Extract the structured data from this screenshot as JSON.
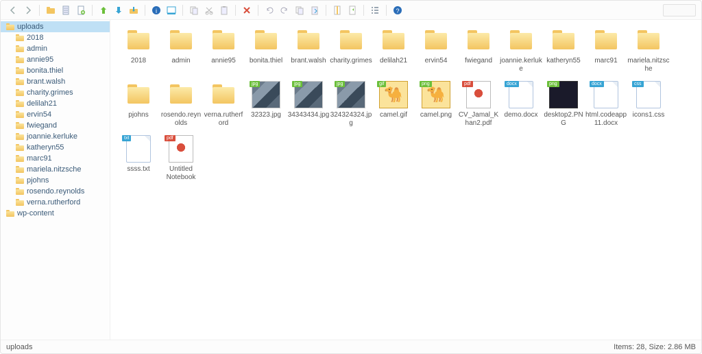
{
  "toolbar": [
    {
      "name": "back-icon",
      "svg": "<path d='M9 2 L4 7 L9 12' stroke='#9aa' stroke-width='1.5' fill='none'/>"
    },
    {
      "name": "forward-icon",
      "svg": "<path d='M5 2 L10 7 L5 12' stroke='#9aa' stroke-width='1.5' fill='none'/>"
    },
    {
      "sep": true
    },
    {
      "name": "folder-icon",
      "svg": "<rect x='1' y='4' width='12' height='8' rx='1' fill='#f3c561'/><rect x='1' y='2' width='5' height='3' rx='1' fill='#f3c561'/>"
    },
    {
      "name": "document-icon",
      "svg": "<rect x='3' y='1' width='8' height='12' fill='#eef' stroke='#9ab'/><path d='M4 4h6M4 7h6M4 10h6' stroke='#9ab'/>"
    },
    {
      "name": "new-icon",
      "svg": "<rect x='3' y='1' width='8' height='12' fill='#fff' stroke='#9ab'/><circle cx='10' cy='10' r='3' fill='#6b3'/><path d='M10 8v4M8 10h4' stroke='#fff'/>"
    },
    {
      "sep": true
    },
    {
      "name": "upload-icon",
      "svg": "<path d='M7 2 L11 6 L9 6 L9 12 L5 12 L5 6 L3 6 Z' fill='#6bbf3a'/>"
    },
    {
      "name": "download-icon",
      "svg": "<path d='M7 12 L11 8 L9 8 L9 2 L5 2 L5 8 L3 8 Z' fill='#37a4d4'/>"
    },
    {
      "name": "download-folder-icon",
      "svg": "<rect x='1' y='5' width='12' height='7' rx='1' fill='#f3c561'/><path d='M7 9 L9 7 L8 7 L8 2 L6 2 L6 7 L5 7 Z' fill='#37a4d4'/>"
    },
    {
      "sep": true
    },
    {
      "name": "info-icon",
      "svg": "<circle cx='7' cy='7' r='6' fill='#2a6db8'/><text x='7' y='11' font-size='9' text-anchor='middle' fill='#fff'>i</text>"
    },
    {
      "name": "preview-icon",
      "svg": "<rect x='1' y='2' width='12' height='9' fill='#fff' stroke='#37a4d4'/><rect x='1' y='11' width='12' height='2' fill='#37a4d4'/>"
    },
    {
      "sep": true
    },
    {
      "name": "copy-icon",
      "svg": "<rect x='2' y='2' width='7' height='9' fill='none' stroke='#bbb'/><rect x='5' y='4' width='7' height='9' fill='#eef' stroke='#bbb'/>"
    },
    {
      "name": "cut-icon",
      "svg": "<path d='M3 3 L11 11 M11 3 L3 11' stroke='#bbb'/><circle cx='4' cy='11' r='2' fill='none' stroke='#bbb'/><circle cx='10' cy='11' r='2' fill='none' stroke='#bbb'/>"
    },
    {
      "name": "paste-icon",
      "svg": "<rect x='3' y='2' width='8' height='11' fill='#eef' stroke='#bbb'/><rect x='5' y='1' width='4' height='2' fill='#bbb'/>"
    },
    {
      "sep": true
    },
    {
      "name": "delete-icon",
      "svg": "<path d='M3 3 L11 11 M11 3 L3 11' stroke='#d94e3c' stroke-width='2'/>"
    },
    {
      "sep": true
    },
    {
      "name": "undo-icon",
      "svg": "<path d='M4 7 A4 4 0 1 1 7 11' fill='none' stroke='#aab'/><path d='M4 4 L4 7 L7 7' fill='none' stroke='#aab'/>"
    },
    {
      "name": "redo-icon",
      "svg": "<path d='M10 7 A4 4 0 1 0 7 11' fill='none' stroke='#aab'/><path d='M10 4 L10 7 L7 7' fill='none' stroke='#aab'/>"
    },
    {
      "name": "copy2-icon",
      "svg": "<rect x='2' y='2' width='7' height='9' fill='none' stroke='#bbb'/><rect x='5' y='4' width='7' height='9' fill='#eef' stroke='#bbb'/>"
    },
    {
      "name": "move-icon",
      "svg": "<rect x='3' y='2' width='8' height='11' fill='#eef' stroke='#bbb'/><path d='M7 5 L10 8 L7 11' fill='none' stroke='#37a4d4'/>"
    },
    {
      "sep": true
    },
    {
      "name": "archive-icon",
      "svg": "<rect x='3' y='1' width='8' height='12' fill='#fff' stroke='#bbb'/><rect x='6' y='1' width='2' height='12' fill='#f3c561'/>"
    },
    {
      "name": "extract-icon",
      "svg": "<rect x='3' y='1' width='8' height='12' fill='#fff' stroke='#bbb'/><path d='M7 6 L9 4 L9 8 Z' fill='#6bbf3a'/>"
    },
    {
      "sep": true
    },
    {
      "name": "list-icon",
      "svg": "<path d='M2 3h2M2 7h2M2 11h2 M6 3h6M6 7h6M6 11h6' stroke='#7a8a9a' stroke-width='1.5'/>"
    },
    {
      "sep": true
    },
    {
      "name": "help-icon",
      "svg": "<circle cx='7' cy='7' r='6' fill='#2a6db8'/><text x='7' y='11' font-size='9' text-anchor='middle' fill='#fff'>?</text>"
    }
  ],
  "tree": [
    {
      "label": "uploads",
      "depth": 0,
      "selected": true
    },
    {
      "label": "2018",
      "depth": 1
    },
    {
      "label": "admin",
      "depth": 1
    },
    {
      "label": "annie95",
      "depth": 1
    },
    {
      "label": "bonita.thiel",
      "depth": 1
    },
    {
      "label": "brant.walsh",
      "depth": 1
    },
    {
      "label": "charity.grimes",
      "depth": 1
    },
    {
      "label": "delilah21",
      "depth": 1
    },
    {
      "label": "ervin54",
      "depth": 1
    },
    {
      "label": "fwiegand",
      "depth": 1
    },
    {
      "label": "joannie.kerluke",
      "depth": 1
    },
    {
      "label": "katheryn55",
      "depth": 1
    },
    {
      "label": "marc91",
      "depth": 1
    },
    {
      "label": "mariela.nitzsche",
      "depth": 1
    },
    {
      "label": "pjohns",
      "depth": 1
    },
    {
      "label": "rosendo.reynolds",
      "depth": 1
    },
    {
      "label": "verna.rutherford",
      "depth": 1
    },
    {
      "label": "wp-content",
      "depth": 0
    }
  ],
  "items": [
    {
      "label": "2018",
      "type": "folder"
    },
    {
      "label": "admin",
      "type": "folder"
    },
    {
      "label": "annie95",
      "type": "folder"
    },
    {
      "label": "bonita.thiel",
      "type": "folder"
    },
    {
      "label": "brant.walsh",
      "type": "folder"
    },
    {
      "label": "charity.grimes",
      "type": "folder"
    },
    {
      "label": "delilah21",
      "type": "folder"
    },
    {
      "label": "ervin54",
      "type": "folder"
    },
    {
      "label": "fwiegand",
      "type": "folder"
    },
    {
      "label": "joannie.kerluke",
      "type": "folder"
    },
    {
      "label": "katheryn55",
      "type": "folder"
    },
    {
      "label": "marc91",
      "type": "folder"
    },
    {
      "label": "mariela.nitzsche",
      "type": "folder"
    },
    {
      "label": "pjohns",
      "type": "folder"
    },
    {
      "label": "rosendo.reynolds",
      "type": "folder"
    },
    {
      "label": "verna.rutherford",
      "type": "folder"
    },
    {
      "label": "32323.jpg",
      "type": "img",
      "badge": "jpg"
    },
    {
      "label": "34343434.jpg",
      "type": "img",
      "badge": "jpg"
    },
    {
      "label": "324324324.jpg",
      "type": "img",
      "badge": "jpg"
    },
    {
      "label": "camel.gif",
      "type": "camel",
      "badge": "gif"
    },
    {
      "label": "camel.png",
      "type": "camel",
      "badge": "png"
    },
    {
      "label": "CV_Jamal_Khan2.pdf",
      "type": "pdf",
      "badge": "pdf"
    },
    {
      "label": "demo.docx",
      "type": "file",
      "badge": "docx"
    },
    {
      "label": "desktop2.PNG",
      "type": "dark",
      "badge": "png"
    },
    {
      "label": "html.codeapp11.docx",
      "type": "file",
      "badge": "docx"
    },
    {
      "label": "icons1.css",
      "type": "file",
      "badge": "css"
    },
    {
      "label": "ssss.txt",
      "type": "file",
      "badge": "txt"
    },
    {
      "label": "Untitled Notebook",
      "type": "pdf",
      "badge": "pdf"
    }
  ],
  "status": {
    "path": "uploads",
    "info": "Items: 28, Size: 2.86 MB"
  }
}
